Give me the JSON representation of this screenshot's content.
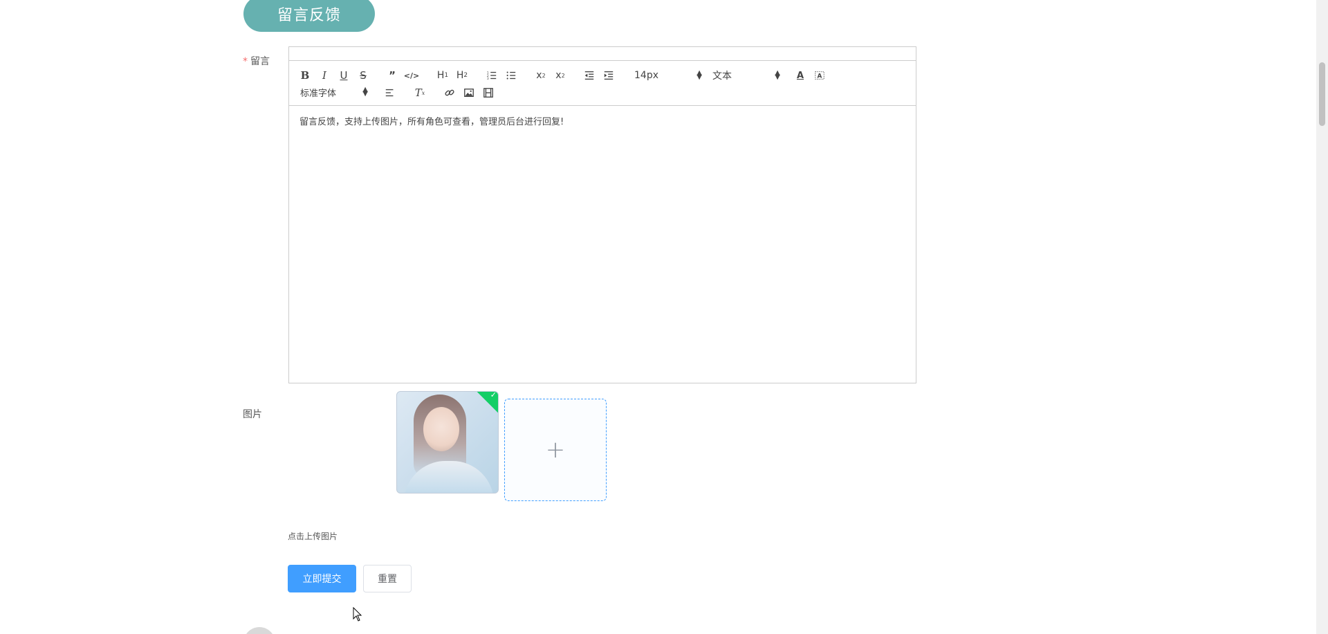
{
  "section_title": "留言反馈",
  "form": {
    "message_label": "留言",
    "required_mark": "*",
    "image_label": "图片",
    "upload_hint": "点击上传图片",
    "submit_label": "立即提交",
    "reset_label": "重置"
  },
  "editor": {
    "font_size_value": "14px",
    "header_value": "文本",
    "font_family_value": "标准字体",
    "content": "留言反馈，支持上传图片，所有角色可查看，管理员后台进行回复!",
    "tools_row1": [
      "bold-icon",
      "italic-icon",
      "underline-icon",
      "strike-icon",
      "blockquote-icon",
      "code-block-icon",
      "h1-icon",
      "h2-icon",
      "ordered-list-icon",
      "bullet-list-icon",
      "subscript-icon",
      "superscript-icon",
      "outdent-icon",
      "indent-icon",
      "font-color-icon",
      "background-color-icon"
    ],
    "tools_row2": [
      "align-left-icon",
      "clear-format-icon",
      "link-icon",
      "image-icon",
      "video-icon"
    ]
  },
  "upload": {
    "status": "success",
    "add_icon": "plus-icon"
  },
  "colors": {
    "title_tab": "#66b1b0",
    "primary": "#409eff",
    "success": "#13ce66",
    "required": "#f56c6c"
  }
}
